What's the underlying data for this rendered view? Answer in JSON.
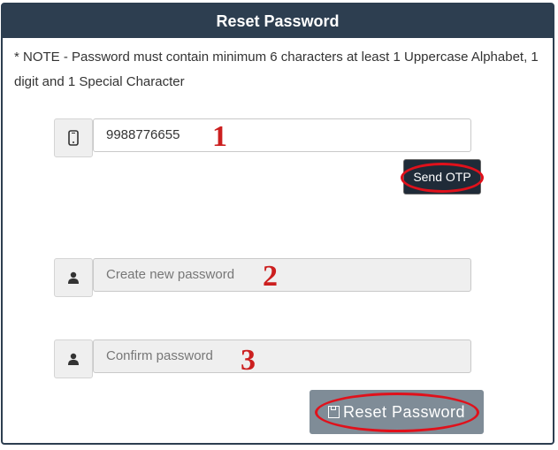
{
  "header": {
    "title": "Reset Password"
  },
  "note": {
    "text": "* NOTE - Password must contain minimum 6 characters at least 1 Uppercase Alphabet, 1 digit and 1 Special Character"
  },
  "phone": {
    "value": "9988776655",
    "icon": "mobile-phone-icon"
  },
  "send_otp": {
    "label": "Send OTP"
  },
  "new_password": {
    "placeholder": "Create new password",
    "icon": "user-icon"
  },
  "confirm_password": {
    "placeholder": "Confirm password",
    "icon": "user-icon"
  },
  "reset_button": {
    "label": "Reset Password",
    "icon": "floppy-disk-icon"
  },
  "annotations": [
    "1",
    "2",
    "3"
  ],
  "colors": {
    "header": "#2d3e50",
    "annotation": "#e0111b",
    "reset_button": "#7f8c97",
    "otp_button": "#1f2b38"
  }
}
